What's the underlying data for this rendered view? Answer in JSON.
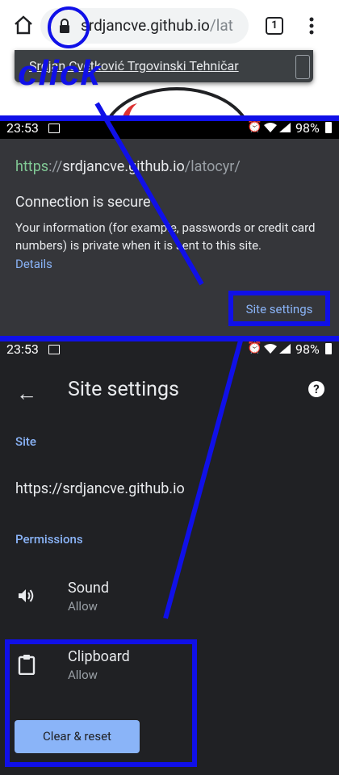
{
  "browser": {
    "url_main": "srdjancve.github.io",
    "url_rest": "/lat",
    "tab_count": "1",
    "dropdown_text": "Srdjan Cvetković Trgovinski Tehničar"
  },
  "annotation": {
    "click_label": "click"
  },
  "status_bar": {
    "time": "23:53",
    "battery": "98%"
  },
  "connection": {
    "scheme": "https",
    "separator": "://",
    "host": "srdjancve.github.io",
    "path": "/latocyr/",
    "title": "Connection is secure",
    "body": "Your information (for example, passwords or credit card numbers) is private when it is sent to this site.",
    "details_link": "Details",
    "site_settings_button": "Site settings"
  },
  "site_settings": {
    "title": "Site settings",
    "site_header": "Site",
    "site_url": "https://srdjancve.github.io",
    "permissions_header": "Permissions",
    "permissions": [
      {
        "name": "Sound",
        "value": "Allow",
        "icon": "speaker-icon"
      },
      {
        "name": "Clipboard",
        "value": "Allow",
        "icon": "clipboard-icon"
      }
    ],
    "clear_button": "Clear & reset"
  }
}
